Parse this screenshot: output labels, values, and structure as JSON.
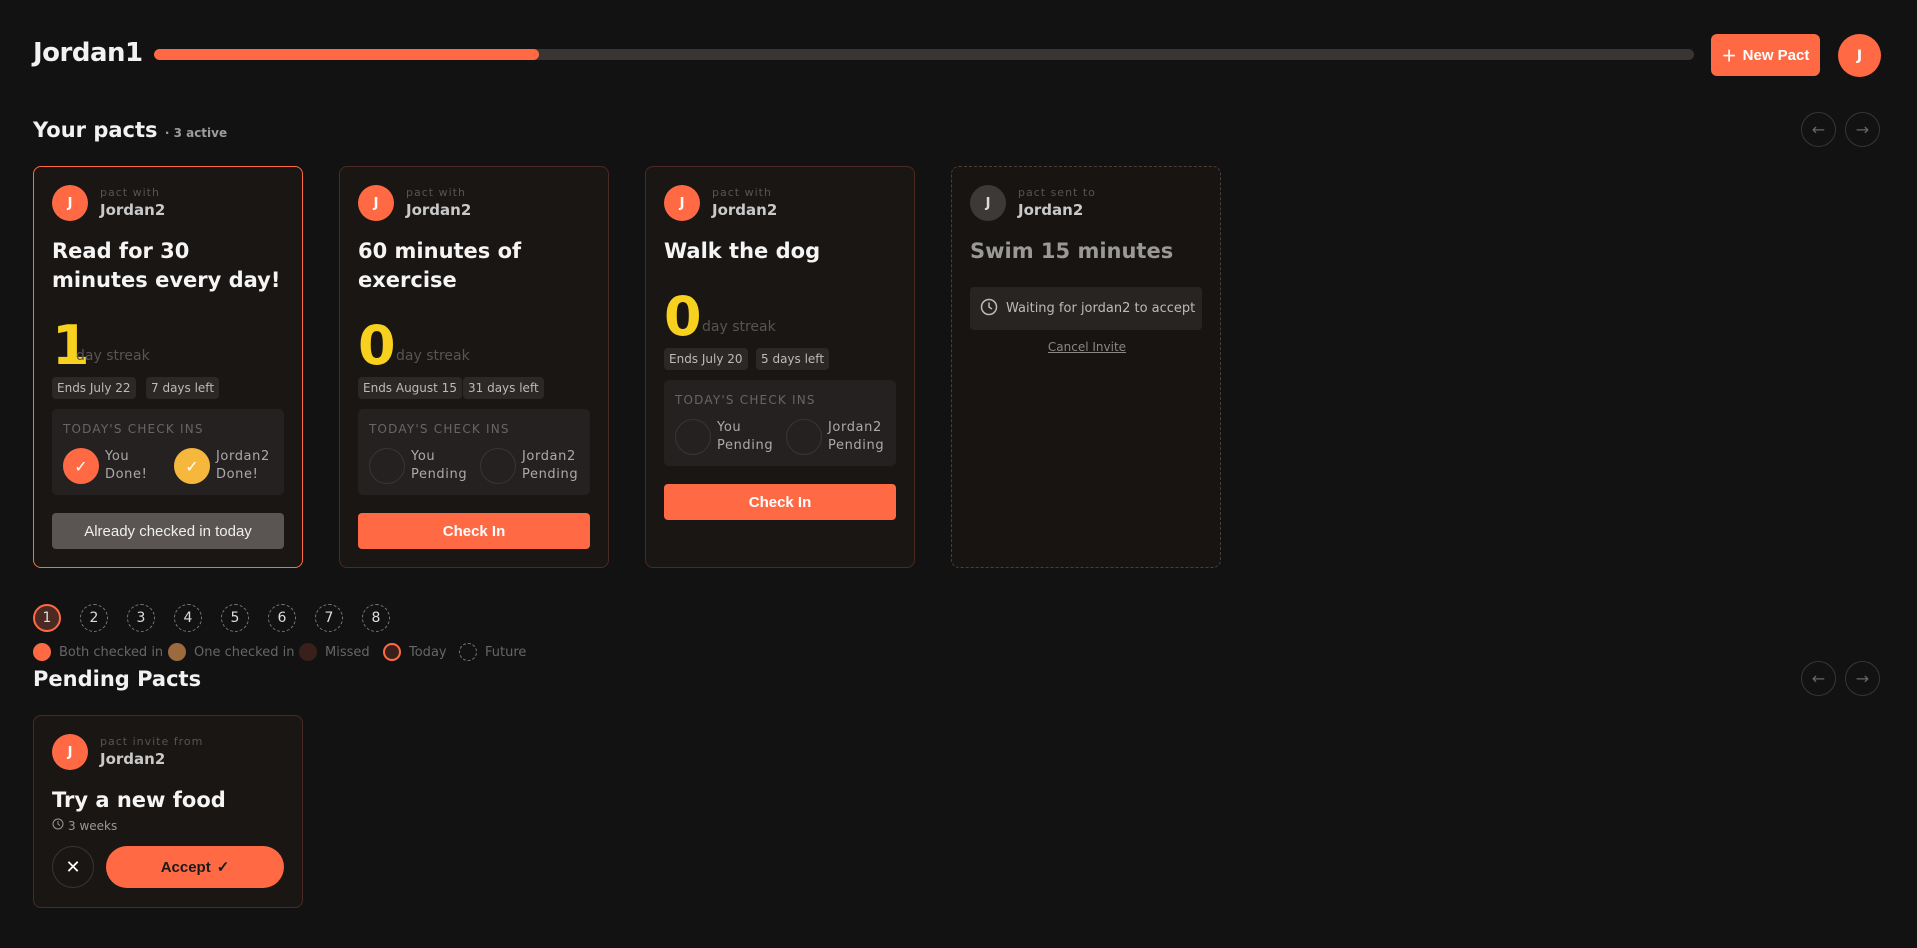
{
  "header": {
    "brand": "Jordan1",
    "progress_pct": 25,
    "new_pact_label": "New Pact",
    "avatar_initial": "J"
  },
  "your_pacts": {
    "title": "Your pacts",
    "active_label": "· 3 active"
  },
  "pacts": [
    {
      "kind": "active",
      "avatar": "J",
      "with_label": "pact with",
      "partner": "Jordan2",
      "title": "Read for 30 minutes every day!",
      "streak": "1",
      "streak_label": "day streak",
      "ends": "Ends July 22",
      "days_left": "7 days left",
      "checkins_label": "TODAY'S CHECK INS",
      "you_label": "You",
      "you_status": "Done!",
      "partner_label": "Jordan2",
      "partner_status": "Done!",
      "button": "Already checked in today"
    },
    {
      "kind": "active",
      "avatar": "J",
      "with_label": "pact with",
      "partner": "Jordan2",
      "title": "60 minutes of exercise",
      "streak": "0",
      "streak_label": "day streak",
      "ends": "Ends August 15",
      "days_left": "31 days left",
      "checkins_label": "TODAY'S CHECK INS",
      "you_label": "You",
      "you_status": "Pending",
      "partner_label": "Jordan2",
      "partner_status": "Pending",
      "button": "Check In"
    },
    {
      "kind": "active",
      "avatar": "J",
      "with_label": "pact with",
      "partner": "Jordan2",
      "title": "Walk the dog",
      "streak": "0",
      "streak_label": "day streak",
      "ends": "Ends July 20",
      "days_left": "5 days left",
      "checkins_label": "TODAY'S CHECK INS",
      "you_label": "You",
      "you_status": "Pending",
      "partner_label": "Jordan2",
      "partner_status": "Pending",
      "button": "Check In"
    },
    {
      "kind": "sent",
      "avatar": "J",
      "with_label": "pact sent to",
      "partner": "Jordan2",
      "title": "Swim 15 minutes",
      "waiting": "Waiting for jordan2 to accept",
      "cancel": "Cancel Invite"
    }
  ],
  "days": [
    "1",
    "2",
    "3",
    "4",
    "5",
    "6",
    "7",
    "8"
  ],
  "legend": {
    "both": "Both checked in",
    "one": "One checked in",
    "missed": "Missed",
    "today": "Today",
    "future": "Future"
  },
  "pending": {
    "title": "Pending Pacts",
    "card": {
      "avatar": "J",
      "from_label": "pact invite from",
      "partner": "Jordan2",
      "title": "Try a new food",
      "duration": "3 weeks",
      "accept": "Accept"
    }
  },
  "colors": {
    "accent": "#ff6a45",
    "streak": "#f7d11e",
    "partner_done": "#f5b83d",
    "bg": "#121212"
  }
}
